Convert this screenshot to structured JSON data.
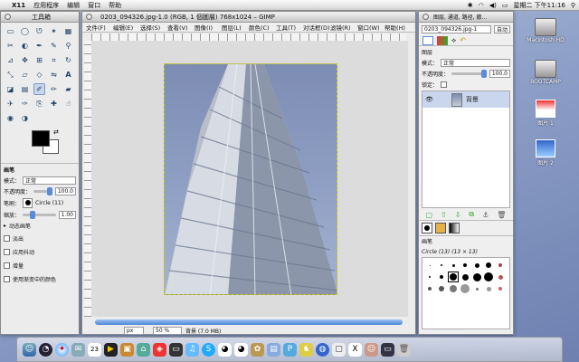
{
  "menubar": {
    "apple": "",
    "app": "X11",
    "items": [
      "应用程序",
      "编辑",
      "窗口",
      "帮助"
    ],
    "clock": "星期二 下午11:16"
  },
  "toolbox": {
    "title": "工具箱",
    "tool_options_title": "画笔",
    "mode_label": "模式：",
    "mode_value": "正常",
    "opacity_label": "不透明度：",
    "opacity_value": "100.0",
    "brush_label": "笔刷：",
    "brush_value": "Circle (11)",
    "scale_label": "缩放：",
    "scale_value": "1.00",
    "dynamics_label": "动态画笔",
    "checks": [
      "淡出",
      "应用抖动",
      "增量",
      "使用渐变中的颜色"
    ]
  },
  "image_window": {
    "title": "0203_094326.jpg-1.0 (RGB, 1 個圖層) 768x1024 – GIMP",
    "menu": [
      "文件(F)",
      "编辑(E)",
      "选择(S)",
      "查看(V)",
      "图像(I)",
      "图层(L)",
      "颜色(C)",
      "工具(T)",
      "对话框(D)",
      "滤镜(R)",
      "窗口(W)",
      "帮助(H)"
    ],
    "unit": "px",
    "zoom": "50 %",
    "status": "背景 (7.0 MB)"
  },
  "layers_window": {
    "title": "图层, 通道, 路径, 撤...",
    "image_select": "0203_094326.jpg-1",
    "auto_label": "自动",
    "section": "图层",
    "mode_label": "模式：",
    "mode_value": "正常",
    "opacity_label": "不透明度：",
    "opacity_value": "100.0",
    "lock_label": "锁定：",
    "layer_name": "背景",
    "brushes_title": "画笔",
    "brushes_sub": "Circle (13) (13 × 13)"
  },
  "desktop_icons": [
    "Macintosh HD",
    "BOOTCAMP",
    "图片 1",
    "图片 2"
  ],
  "dock_items": [
    "finder",
    "dashboard",
    "safari",
    "mail",
    "ical",
    "quicktime",
    "photos",
    "iphoto",
    "ichat",
    "terminal",
    "itunes",
    "x11",
    "preferences",
    "system",
    "trash"
  ],
  "colors": {
    "accent": "#5b8ad8",
    "selection": "#c8d6ee",
    "layer_row": "#cad6ee"
  }
}
